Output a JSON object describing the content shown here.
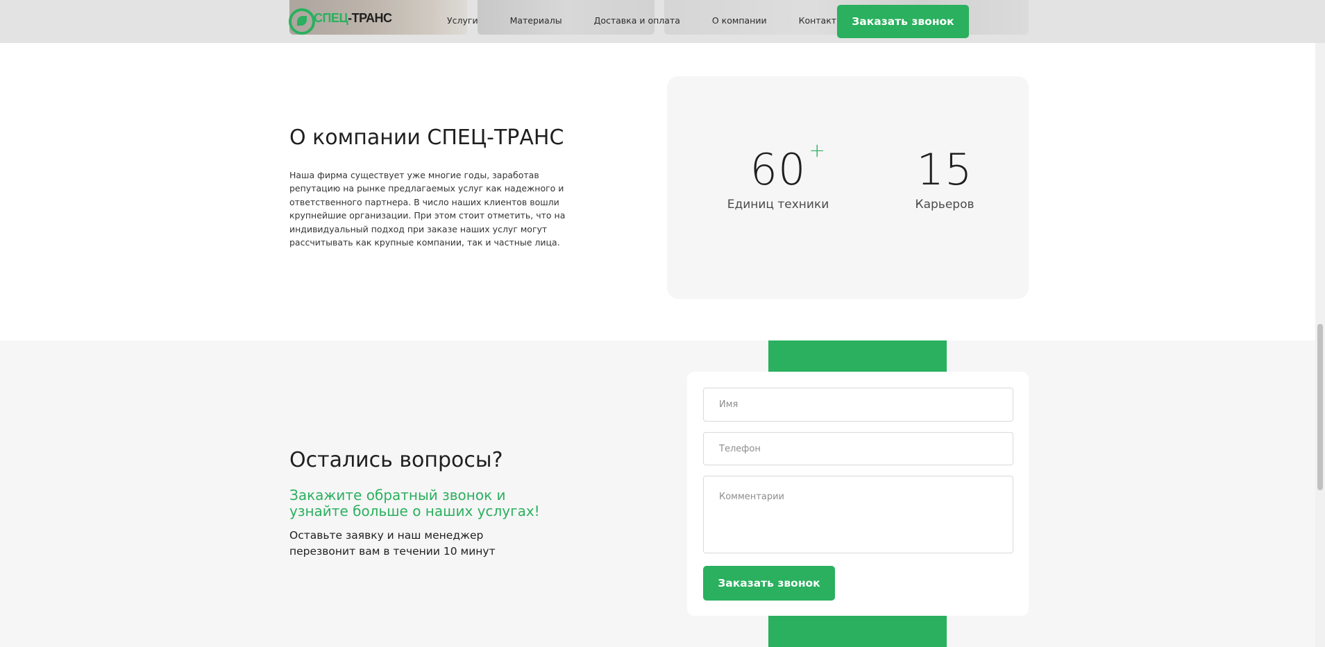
{
  "header": {
    "logo": {
      "part1": "СПЕЦ",
      "part2": "-ТРАНС"
    },
    "nav": [
      "Услуги",
      "Материалы",
      "Доставка и оплата",
      "О компании",
      "Контакты"
    ],
    "cta_label": "Заказать звонок"
  },
  "about": {
    "title": "О компании СПЕЦ-ТРАНС",
    "text": "Наша фирма существует уже многие годы, заработав репутацию на рынке предлагаемых услуг как надежного и ответственного партнера. В число наших клиентов вошли крупнейшие организации. При этом стоит отметить, что на индивидуальный подход при заказе наших услуг могут рассчитывать как крупные компании, так и частные лица.",
    "stats": [
      {
        "value": "60",
        "suffix": "+",
        "label": "Единиц техники"
      },
      {
        "value": "15",
        "suffix": "",
        "label": "Карьеров"
      }
    ]
  },
  "contact": {
    "title": "Остались вопросы?",
    "subtitle": "Закажите обратный звонок и узнайте больше о наших услугах!",
    "text": "Оставьте заявку и наш менеджер перезвонит вам в течении 10 минут",
    "form": {
      "name_placeholder": "Имя",
      "phone_placeholder": "Телефон",
      "comment_placeholder": "Комментарии",
      "submit_label": "Заказать звонок"
    }
  },
  "colors": {
    "accent": "#2ab05e",
    "section_bg": "#f6f6f6",
    "header_bg": "#e3e3e3"
  }
}
